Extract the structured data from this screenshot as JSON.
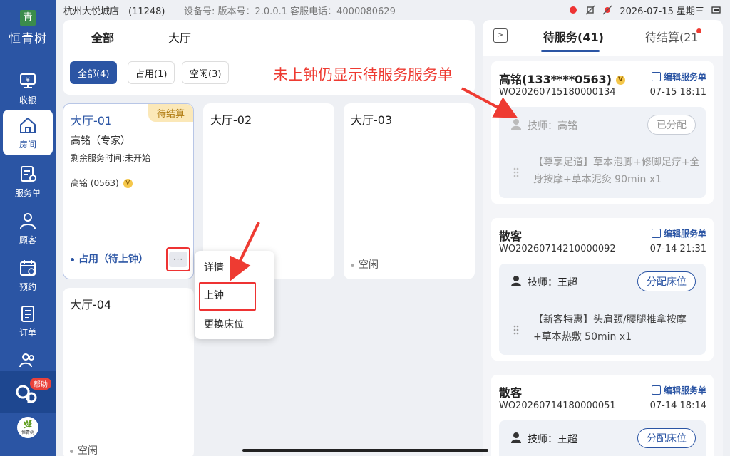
{
  "status_bar": {
    "store": "杭州大悦城店　(11248)",
    "device_info": "设备号:  版本号：2.0.0.1   客服电话：4000080629",
    "datetime": "2026-07-15 星期三"
  },
  "sidebar": {
    "logo_mark": "青",
    "logo_text": "恒青树",
    "items": [
      {
        "label": "收银",
        "icon": "cashier-icon"
      },
      {
        "label": "房间",
        "icon": "home-icon"
      },
      {
        "label": "服务单",
        "icon": "service-order-icon"
      },
      {
        "label": "顾客",
        "icon": "customer-icon"
      },
      {
        "label": "预约",
        "icon": "calendar-icon"
      },
      {
        "label": "订单",
        "icon": "order-icon"
      },
      {
        "label": "",
        "icon": "staff-icon"
      }
    ],
    "help_label": "帮助",
    "bottom_logo": "恒青树"
  },
  "area_tabs": {
    "all": "全部",
    "hall": "大厅"
  },
  "filters": [
    {
      "label": "全部(4)"
    },
    {
      "label": "占用(1)"
    },
    {
      "label": "空闲(3)"
    }
  ],
  "rooms": [
    {
      "name": "大厅-01",
      "tag": "待结算",
      "customer": "高铭（专家）",
      "remaining": "剩余服务时间:未开始",
      "staff": "高铭 (0563)",
      "status": "占用（待上钟）",
      "more": "···"
    },
    {
      "name": "大厅-02",
      "status": ""
    },
    {
      "name": "大厅-03",
      "status": "空闲"
    },
    {
      "name": "大厅-04",
      "status": "空闲"
    }
  ],
  "menu": {
    "items": [
      "详情",
      "上钟",
      "更换床位"
    ]
  },
  "annotation": "未上钟仍显示待服务服务单",
  "right_panel": {
    "tab_waiting": "待服务(41)",
    "tab_settle": "待结算(21",
    "edit_label": "编辑服务单",
    "orders": [
      {
        "name": "高铭(133****0563)",
        "vip": "V",
        "order_no": "WO20260715180000134",
        "time": "07-15 18:11",
        "technician": "技师：高铭",
        "button": "已分配",
        "service": "【尊享足道】草本泡脚+修脚足疗+全身按摩+草本泥灸 90min x1"
      },
      {
        "name": "散客",
        "order_no": "WO20260714210000092",
        "time": "07-14 21:31",
        "technician": "技师：王超",
        "button": "分配床位",
        "service": "【新客特惠】头肩颈/腰腿推拿按摩+草本热敷 50min x1"
      },
      {
        "name": "散客",
        "order_no": "WO20260714180000051",
        "time": "07-14 18:14",
        "technician": "技师：王超",
        "button": "分配床位"
      }
    ]
  },
  "colors": {
    "primary": "#2b55a4",
    "annotation": "#ee3b32",
    "pending_tag": "#fbe8b8"
  }
}
